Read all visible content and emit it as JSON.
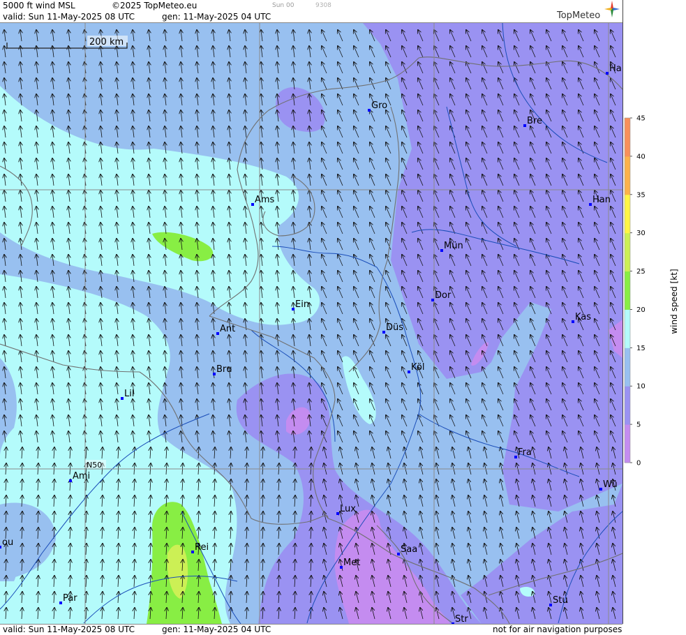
{
  "header": {
    "product": "5000 ft wind MSL",
    "copyright": "©2025 TopMeteo.eu",
    "small_a": "Sun 00",
    "small_b": "9308",
    "valid": "valid:  Sun  11-May-2025  08 UTC",
    "gen": "gen: 11-May-2025 04 UTC",
    "logo": "TopMeteo"
  },
  "footer": {
    "valid": "valid:  Sun  11-May-2025  08 UTC",
    "gen": "gen: 11-May-2025 04 UTC",
    "disclaimer": "not for air navigation purposes"
  },
  "map": {
    "scale_label": "200 km",
    "lat_label": "N50",
    "cities": [
      {
        "name": "Gro"
      },
      {
        "name": "Bre"
      },
      {
        "name": "Ha"
      },
      {
        "name": "Ams"
      },
      {
        "name": "Han"
      },
      {
        "name": "Mün"
      },
      {
        "name": "Dor"
      },
      {
        "name": "Ein"
      },
      {
        "name": "Kas"
      },
      {
        "name": "Ant"
      },
      {
        "name": "Düs"
      },
      {
        "name": "Bru"
      },
      {
        "name": "Köl"
      },
      {
        "name": "Lil"
      },
      {
        "name": "Fra"
      },
      {
        "name": "Ami"
      },
      {
        "name": "Wü"
      },
      {
        "name": "Lux"
      },
      {
        "name": "ou"
      },
      {
        "name": "Rei"
      },
      {
        "name": "Saa"
      },
      {
        "name": "Met"
      },
      {
        "name": "Par"
      },
      {
        "name": "Stu"
      },
      {
        "name": "Str"
      }
    ],
    "wind_direction": "south-southeast",
    "colors": {
      "water_lines": "#1a4db8",
      "borders": "#707070",
      "city_marker": "#0000ff"
    }
  },
  "colorbar": {
    "label": "wind speed [kt]",
    "ticks": [
      "45",
      "40",
      "35",
      "30",
      "25",
      "20",
      "15",
      "10",
      "5",
      "0"
    ],
    "colors": [
      "#c48cf0",
      "#9a92f2",
      "#98c0f0",
      "#b4fbfb",
      "#88ee44",
      "#ccf055",
      "#fff544",
      "#fcb24a",
      "#f8905a",
      "#f47a62"
    ]
  }
}
